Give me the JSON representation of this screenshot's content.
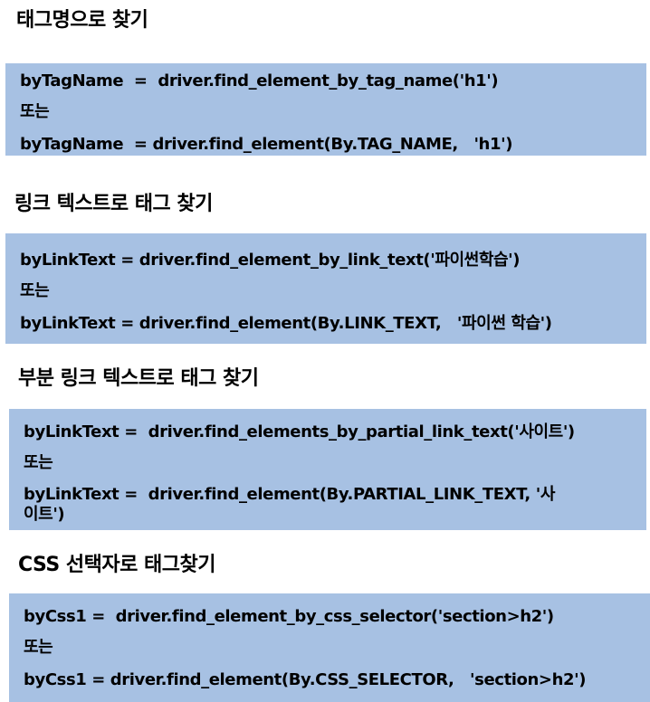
{
  "sections": [
    {
      "heading": "태그명으로 찾기",
      "line1": "byTagName  =  driver.find_element_by_tag_name('h1')",
      "or": "또는",
      "line2": "byTagName  = driver.find_element(By.TAG_NAME,   'h1')"
    },
    {
      "heading": "링크 텍스트로 태그 찾기",
      "line1": "byLinkText = driver.find_element_by_link_text('파이썬학습')",
      "or": "또는",
      "line2": "byLinkText = driver.find_element(By.LINK_TEXT,   '파이썬 학습')"
    },
    {
      "heading": "부분 링크 텍스트로 태그 찾기",
      "line1": "byLinkText =  driver.find_elements_by_partial_link_text('사이트')",
      "or": "또는",
      "line2": "byLinkText =  driver.find_element(By.PARTIAL_LINK_TEXT, '사이트')"
    },
    {
      "heading": "CSS 선택자로 태그찾기",
      "line1": "byCss1 =  driver.find_element_by_css_selector('section>h2')",
      "or": "또는",
      "line2": "byCss1 = driver.find_element(By.CSS_SELECTOR,   'section>h2')"
    }
  ]
}
